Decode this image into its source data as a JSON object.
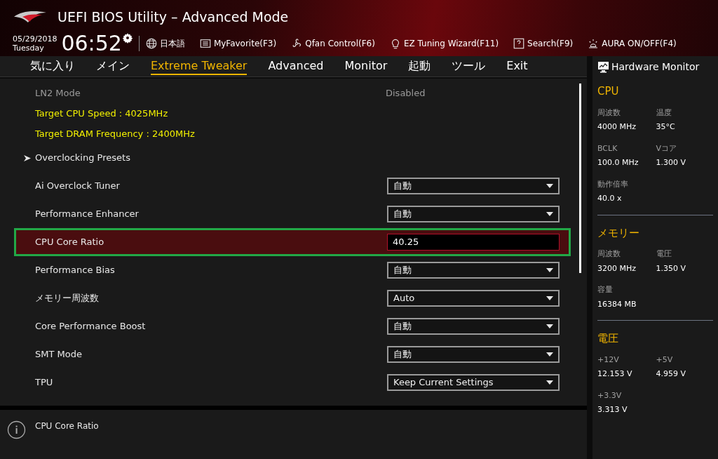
{
  "header": {
    "title": "UEFI BIOS Utility – Advanced Mode",
    "date": "05/29/2018",
    "day": "Tuesday",
    "time": "06:52",
    "tools": [
      {
        "kind": "language",
        "label": "日本語"
      },
      {
        "kind": "favorite",
        "label": "MyFavorite(F3)"
      },
      {
        "kind": "fan",
        "label": "Qfan Control(F6)"
      },
      {
        "kind": "bulb",
        "label": "EZ Tuning Wizard(F11)"
      },
      {
        "kind": "help",
        "label": "Search(F9)"
      },
      {
        "kind": "aura",
        "label": "AURA ON/OFF(F4)"
      }
    ]
  },
  "tabs": [
    {
      "label": "気に入り",
      "selected": false
    },
    {
      "label": "メイン",
      "selected": false
    },
    {
      "label": "Extreme Tweaker",
      "selected": true
    },
    {
      "label": "Advanced",
      "selected": false
    },
    {
      "label": "Monitor",
      "selected": false
    },
    {
      "label": "起動",
      "selected": false
    },
    {
      "label": "ツール",
      "selected": false
    },
    {
      "label": "Exit",
      "selected": false
    }
  ],
  "settings": [
    {
      "kind": "readonly",
      "label": "LN2 Mode",
      "value": "Disabled",
      "selected": false
    },
    {
      "kind": "info",
      "label": "Target CPU Speed : 4025MHz",
      "selected": false
    },
    {
      "kind": "info",
      "label": "Target DRAM Frequency : 2400MHz",
      "selected": false
    },
    {
      "kind": "submenu",
      "label": "Overclocking Presets",
      "selected": false
    },
    {
      "kind": "dropdown",
      "label": "Ai Overclock Tuner",
      "value": "自動",
      "selected": false
    },
    {
      "kind": "dropdown",
      "label": "Performance Enhancer",
      "value": "自動",
      "selected": false
    },
    {
      "kind": "input",
      "label": "CPU Core Ratio",
      "value": "40.25",
      "selected": true
    },
    {
      "kind": "dropdown",
      "label": "Performance Bias",
      "value": "自動",
      "selected": false
    },
    {
      "kind": "dropdown",
      "label": "メモリー周波数",
      "value": "Auto",
      "selected": false
    },
    {
      "kind": "dropdown",
      "label": "Core Performance Boost",
      "value": "自動",
      "selected": false
    },
    {
      "kind": "dropdown",
      "label": "SMT Mode",
      "value": "自動",
      "selected": false
    },
    {
      "kind": "dropdown",
      "label": "TPU",
      "value": "Keep Current Settings",
      "selected": false
    }
  ],
  "help": {
    "text": "CPU Core Ratio"
  },
  "hardware_monitor": {
    "title": "Hardware Monitor",
    "sections": [
      {
        "title": "CPU",
        "items": [
          {
            "label": "周波数",
            "value": "4000 MHz"
          },
          {
            "label": "温度",
            "value": "35°C"
          },
          {
            "label": "BCLK",
            "value": "100.0 MHz"
          },
          {
            "label": "Vコア",
            "value": "1.300 V"
          },
          {
            "label": "動作倍率",
            "value": "40.0 x"
          }
        ]
      },
      {
        "title": "メモリー",
        "items": [
          {
            "label": "周波数",
            "value": "3200 MHz"
          },
          {
            "label": "電圧",
            "value": "1.350 V"
          },
          {
            "label": "容量",
            "value": "16384 MB"
          }
        ]
      },
      {
        "title": "電圧",
        "items": [
          {
            "label": "+12V",
            "value": "12.153 V"
          },
          {
            "label": "+5V",
            "value": "4.959 V"
          },
          {
            "label": "+3.3V",
            "value": "3.313 V"
          }
        ]
      }
    ]
  }
}
